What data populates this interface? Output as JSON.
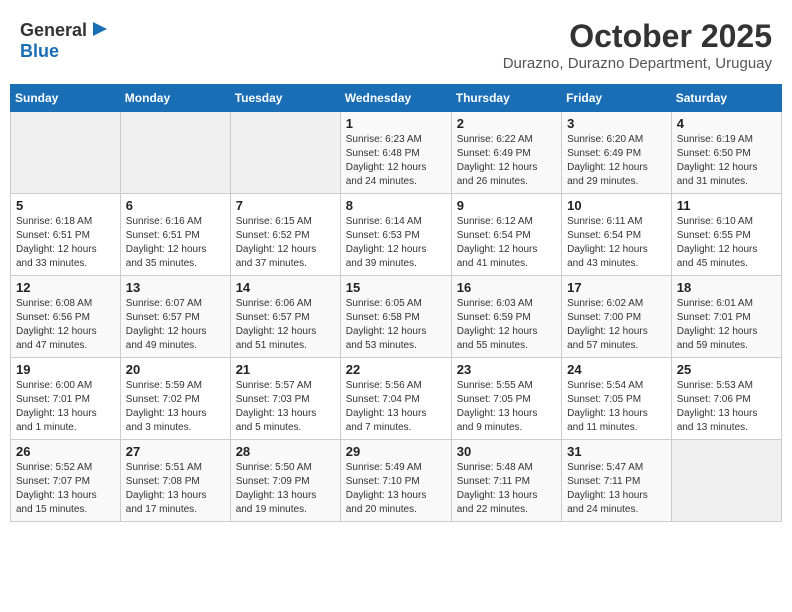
{
  "header": {
    "logo_general": "General",
    "logo_blue": "Blue",
    "month": "October 2025",
    "location": "Durazno, Durazno Department, Uruguay"
  },
  "days_of_week": [
    "Sunday",
    "Monday",
    "Tuesday",
    "Wednesday",
    "Thursday",
    "Friday",
    "Saturday"
  ],
  "weeks": [
    [
      {
        "day": "",
        "info": ""
      },
      {
        "day": "",
        "info": ""
      },
      {
        "day": "",
        "info": ""
      },
      {
        "day": "1",
        "info": "Sunrise: 6:23 AM\nSunset: 6:48 PM\nDaylight: 12 hours\nand 24 minutes."
      },
      {
        "day": "2",
        "info": "Sunrise: 6:22 AM\nSunset: 6:49 PM\nDaylight: 12 hours\nand 26 minutes."
      },
      {
        "day": "3",
        "info": "Sunrise: 6:20 AM\nSunset: 6:49 PM\nDaylight: 12 hours\nand 29 minutes."
      },
      {
        "day": "4",
        "info": "Sunrise: 6:19 AM\nSunset: 6:50 PM\nDaylight: 12 hours\nand 31 minutes."
      }
    ],
    [
      {
        "day": "5",
        "info": "Sunrise: 6:18 AM\nSunset: 6:51 PM\nDaylight: 12 hours\nand 33 minutes."
      },
      {
        "day": "6",
        "info": "Sunrise: 6:16 AM\nSunset: 6:51 PM\nDaylight: 12 hours\nand 35 minutes."
      },
      {
        "day": "7",
        "info": "Sunrise: 6:15 AM\nSunset: 6:52 PM\nDaylight: 12 hours\nand 37 minutes."
      },
      {
        "day": "8",
        "info": "Sunrise: 6:14 AM\nSunset: 6:53 PM\nDaylight: 12 hours\nand 39 minutes."
      },
      {
        "day": "9",
        "info": "Sunrise: 6:12 AM\nSunset: 6:54 PM\nDaylight: 12 hours\nand 41 minutes."
      },
      {
        "day": "10",
        "info": "Sunrise: 6:11 AM\nSunset: 6:54 PM\nDaylight: 12 hours\nand 43 minutes."
      },
      {
        "day": "11",
        "info": "Sunrise: 6:10 AM\nSunset: 6:55 PM\nDaylight: 12 hours\nand 45 minutes."
      }
    ],
    [
      {
        "day": "12",
        "info": "Sunrise: 6:08 AM\nSunset: 6:56 PM\nDaylight: 12 hours\nand 47 minutes."
      },
      {
        "day": "13",
        "info": "Sunrise: 6:07 AM\nSunset: 6:57 PM\nDaylight: 12 hours\nand 49 minutes."
      },
      {
        "day": "14",
        "info": "Sunrise: 6:06 AM\nSunset: 6:57 PM\nDaylight: 12 hours\nand 51 minutes."
      },
      {
        "day": "15",
        "info": "Sunrise: 6:05 AM\nSunset: 6:58 PM\nDaylight: 12 hours\nand 53 minutes."
      },
      {
        "day": "16",
        "info": "Sunrise: 6:03 AM\nSunset: 6:59 PM\nDaylight: 12 hours\nand 55 minutes."
      },
      {
        "day": "17",
        "info": "Sunrise: 6:02 AM\nSunset: 7:00 PM\nDaylight: 12 hours\nand 57 minutes."
      },
      {
        "day": "18",
        "info": "Sunrise: 6:01 AM\nSunset: 7:01 PM\nDaylight: 12 hours\nand 59 minutes."
      }
    ],
    [
      {
        "day": "19",
        "info": "Sunrise: 6:00 AM\nSunset: 7:01 PM\nDaylight: 13 hours\nand 1 minute."
      },
      {
        "day": "20",
        "info": "Sunrise: 5:59 AM\nSunset: 7:02 PM\nDaylight: 13 hours\nand 3 minutes."
      },
      {
        "day": "21",
        "info": "Sunrise: 5:57 AM\nSunset: 7:03 PM\nDaylight: 13 hours\nand 5 minutes."
      },
      {
        "day": "22",
        "info": "Sunrise: 5:56 AM\nSunset: 7:04 PM\nDaylight: 13 hours\nand 7 minutes."
      },
      {
        "day": "23",
        "info": "Sunrise: 5:55 AM\nSunset: 7:05 PM\nDaylight: 13 hours\nand 9 minutes."
      },
      {
        "day": "24",
        "info": "Sunrise: 5:54 AM\nSunset: 7:05 PM\nDaylight: 13 hours\nand 11 minutes."
      },
      {
        "day": "25",
        "info": "Sunrise: 5:53 AM\nSunset: 7:06 PM\nDaylight: 13 hours\nand 13 minutes."
      }
    ],
    [
      {
        "day": "26",
        "info": "Sunrise: 5:52 AM\nSunset: 7:07 PM\nDaylight: 13 hours\nand 15 minutes."
      },
      {
        "day": "27",
        "info": "Sunrise: 5:51 AM\nSunset: 7:08 PM\nDaylight: 13 hours\nand 17 minutes."
      },
      {
        "day": "28",
        "info": "Sunrise: 5:50 AM\nSunset: 7:09 PM\nDaylight: 13 hours\nand 19 minutes."
      },
      {
        "day": "29",
        "info": "Sunrise: 5:49 AM\nSunset: 7:10 PM\nDaylight: 13 hours\nand 20 minutes."
      },
      {
        "day": "30",
        "info": "Sunrise: 5:48 AM\nSunset: 7:11 PM\nDaylight: 13 hours\nand 22 minutes."
      },
      {
        "day": "31",
        "info": "Sunrise: 5:47 AM\nSunset: 7:11 PM\nDaylight: 13 hours\nand 24 minutes."
      },
      {
        "day": "",
        "info": ""
      }
    ]
  ]
}
